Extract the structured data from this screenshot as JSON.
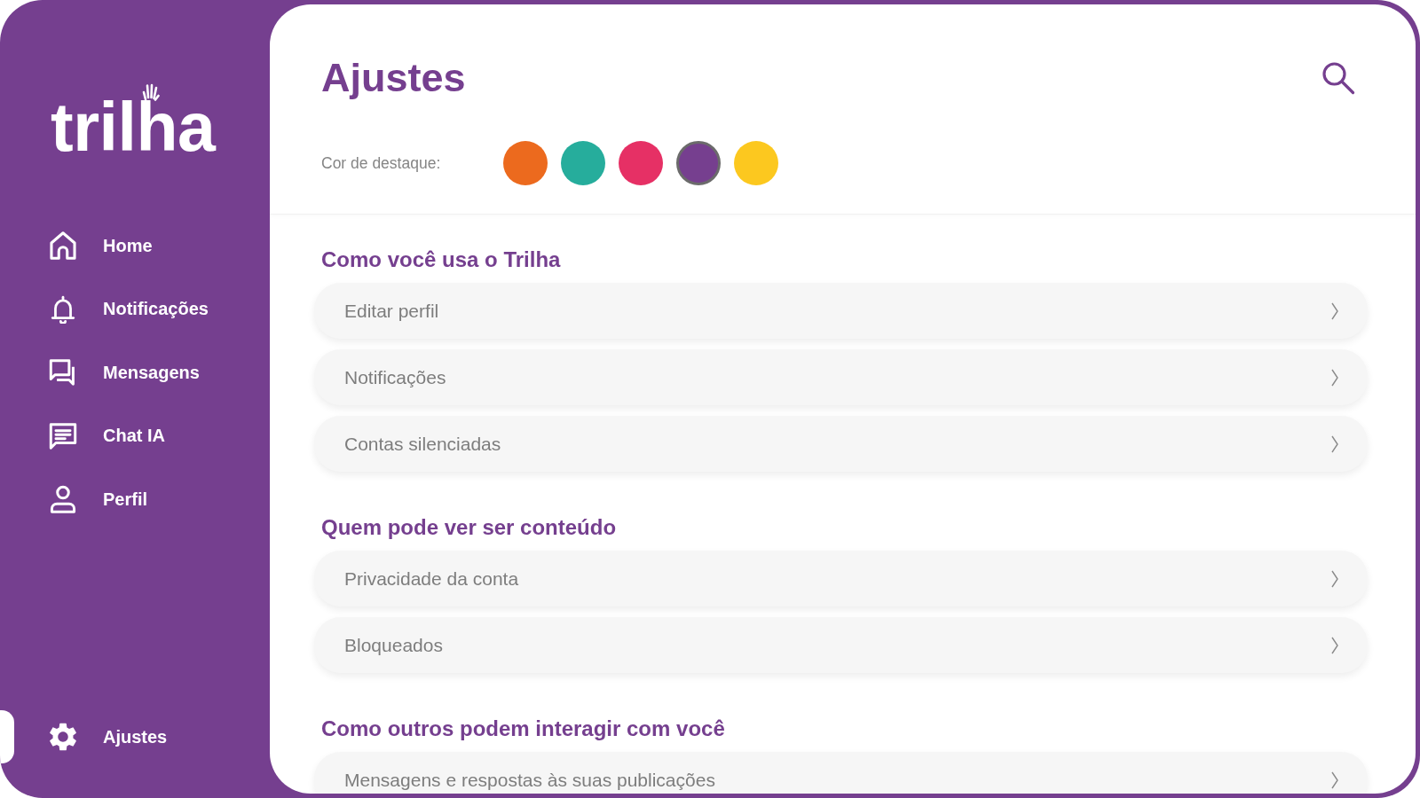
{
  "sidebar": {
    "logo": "trilha",
    "items": [
      {
        "label": "Home",
        "selected": false
      },
      {
        "label": "Notificações",
        "selected": false
      },
      {
        "label": "Mensagens",
        "selected": false
      },
      {
        "label": "Chat IA",
        "selected": false
      },
      {
        "label": "Perfil",
        "selected": false
      }
    ],
    "bottom_items": [
      {
        "label": "Ajustes",
        "selected": true
      }
    ]
  },
  "header": {
    "title": "Ajustes",
    "accent_label": "Cor de destaque:",
    "accent_colors": [
      {
        "color": "#ec6a1e",
        "selected": false
      },
      {
        "color": "#26ad9c",
        "selected": false
      },
      {
        "color": "#e63065",
        "selected": false
      },
      {
        "color": "#763f8f",
        "selected": true
      },
      {
        "color": "#fcc81f",
        "selected": false
      }
    ]
  },
  "sections": [
    {
      "title": "Como você usa o Trilha",
      "items": [
        {
          "label": "Editar perfil"
        },
        {
          "label": "Notificações"
        },
        {
          "label": "Contas silenciadas"
        }
      ]
    },
    {
      "title": "Quem pode ver ser conteúdo",
      "items": [
        {
          "label": "Privacidade da conta"
        },
        {
          "label": "Bloqueados"
        }
      ]
    },
    {
      "title": "Como outros podem interagir com você",
      "items": [
        {
          "label": "Mensagens e respostas às suas publicações"
        }
      ]
    }
  ]
}
